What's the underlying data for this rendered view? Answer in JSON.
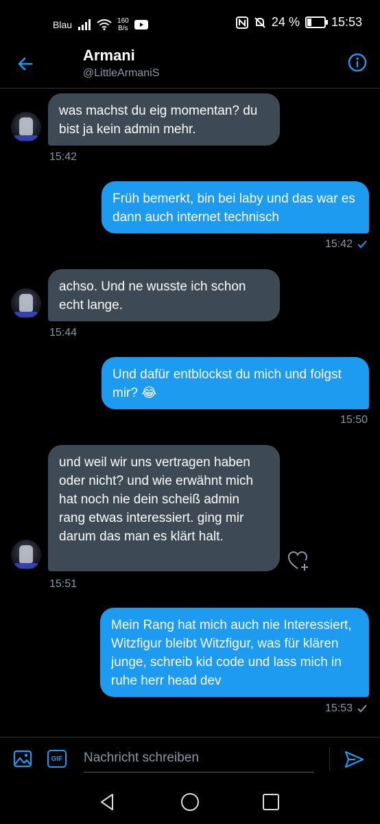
{
  "status": {
    "carrier": "Blau",
    "net_speed_value": "160",
    "net_speed_unit": "B/s",
    "battery_percent": "24 %",
    "battery_level": 0.24,
    "time": "15:53"
  },
  "header": {
    "name": "Armani",
    "handle": "@LittleArmaniS"
  },
  "messages": [
    {
      "dir": "in",
      "text": "was machst du eig momentan? du bist ja kein admin mehr.",
      "time": "15:42"
    },
    {
      "dir": "out",
      "text": "Früh bemerkt, bin bei laby und das war es dann auch internet technisch",
      "time": "15:42"
    },
    {
      "dir": "in",
      "text": "achso. Und ne wusste ich schon echt lange.",
      "time": "15:44"
    },
    {
      "dir": "out",
      "text": "Und dafür entblockst du mich und folgst mir? 😂",
      "time": "15:50"
    },
    {
      "dir": "in",
      "text": "und weil wir uns vertragen haben oder nicht? und wie erwähnt mich hat noch nie dein scheiß admin rang etwas interessiert. ging mir darum das man es klärt halt.",
      "time": "15:51"
    },
    {
      "dir": "out",
      "text": "Mein Rang hat mich auch nie Interessiert, Witzfigur bleibt Witzfigur, was für klären junge, schreib kid code und lass mich in ruhe herr head dev",
      "time": "15:53"
    }
  ],
  "composer": {
    "gif_label": "GIF",
    "placeholder": "Nachricht schreiben"
  },
  "colors": {
    "accent": "#1d9bf0",
    "incoming_bubble": "#3d4a55",
    "background": "#000000"
  },
  "icons": [
    "back-arrow-icon",
    "info-icon",
    "image-icon",
    "gif-icon",
    "send-icon",
    "heart-plus-icon",
    "nav-back-icon",
    "nav-home-icon",
    "nav-recents-icon",
    "read-check-icon"
  ]
}
